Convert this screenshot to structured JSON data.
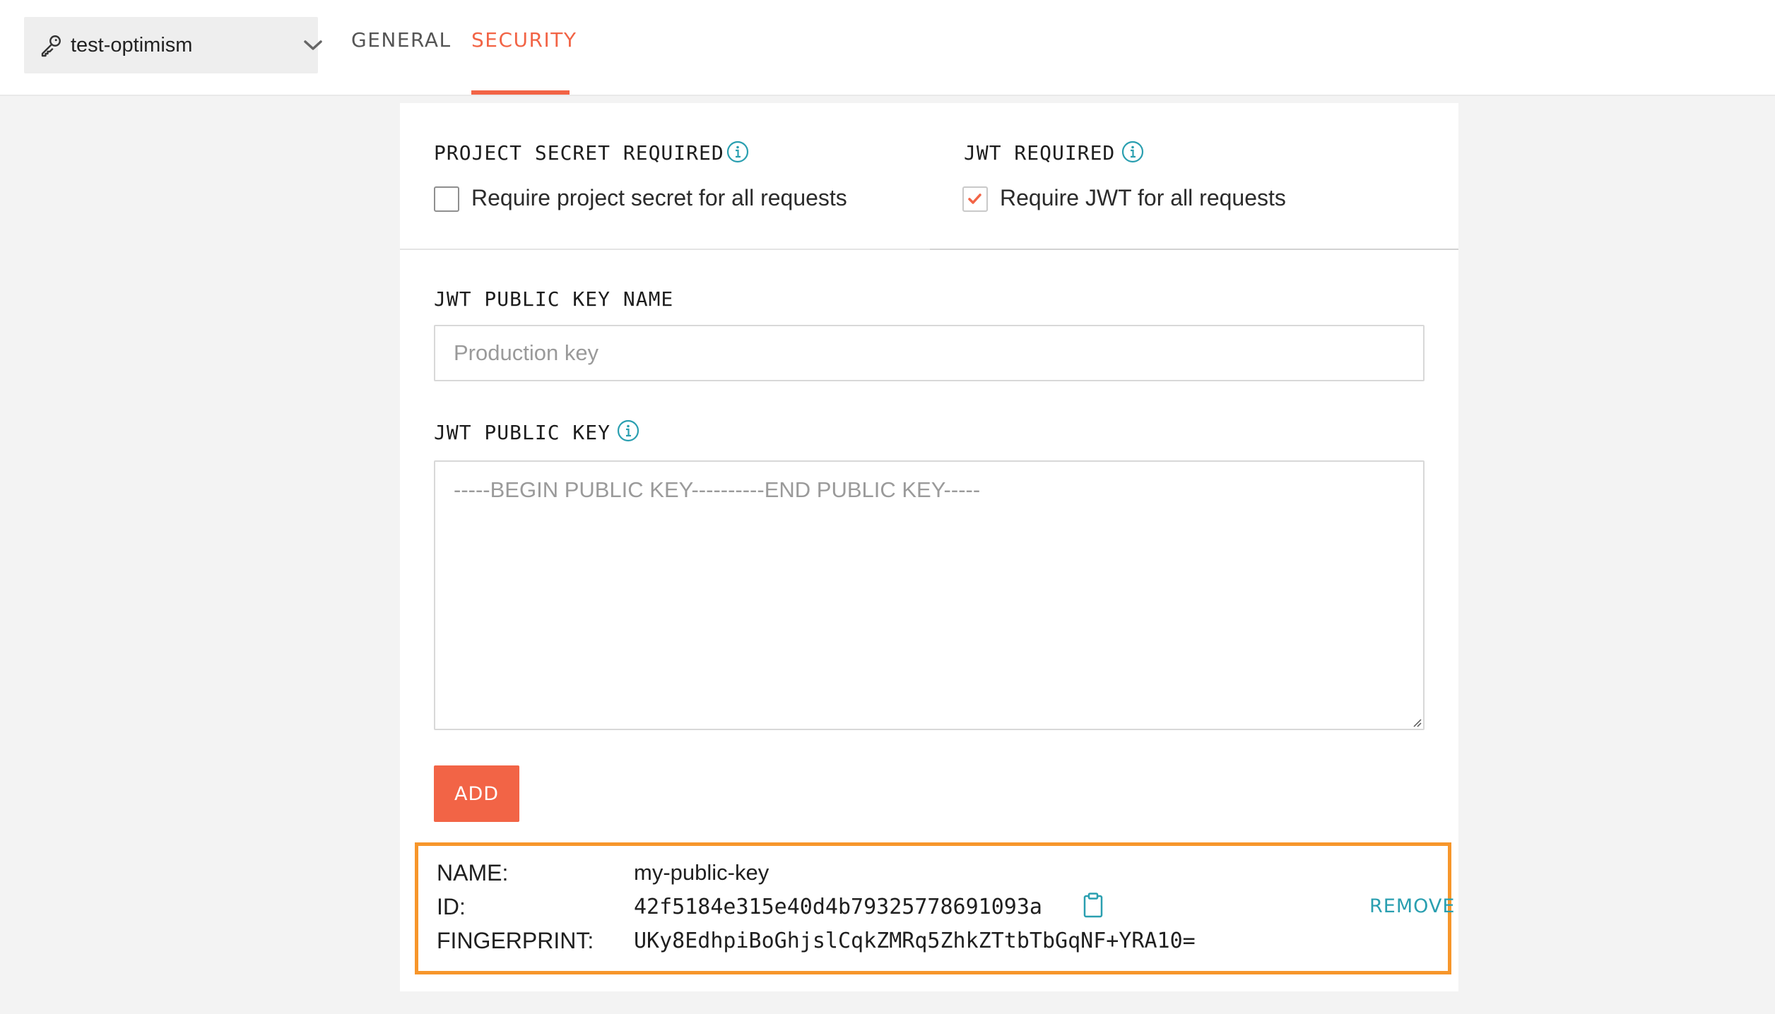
{
  "header": {
    "project_name": "test-optimism",
    "tabs": [
      {
        "label": "GENERAL",
        "active": false
      },
      {
        "label": "SECURITY",
        "active": true
      }
    ]
  },
  "security": {
    "project_secret": {
      "label": "PROJECT SECRET REQUIRED",
      "checkbox_label": "Require project secret for all requests",
      "checked": false
    },
    "jwt_required": {
      "label": "JWT REQUIRED",
      "checkbox_label": "Require JWT for all requests",
      "checked": true
    },
    "jwt_key_name": {
      "label": "JWT PUBLIC KEY NAME",
      "placeholder": "Production key",
      "value": ""
    },
    "jwt_public_key": {
      "label": "JWT PUBLIC KEY",
      "placeholder": "-----BEGIN PUBLIC KEY----------END PUBLIC KEY-----",
      "value": ""
    },
    "add_label": "ADD"
  },
  "saved_key": {
    "name_label": "NAME:",
    "name_value": "my-public-key",
    "id_label": "ID:",
    "id_value": "42f5184e315e40d4b79325778691093a",
    "fingerprint_label": "FINGERPRINT:",
    "fingerprint_value": "UKy8EdhpiBoGhjslCqkZMRq5ZhkZTtbTbGqNF+YRA10=",
    "remove_label": "REMOVE"
  },
  "colors": {
    "accent": "#f26446",
    "highlight_border": "#f7962b",
    "link": "#2a9fb0",
    "info": "#2a9fb0"
  },
  "icons": {
    "project_select": "key-icon",
    "dropdown": "chevron-down-icon",
    "info": "info-icon",
    "check": "check-icon",
    "copy": "clipboard-icon"
  }
}
